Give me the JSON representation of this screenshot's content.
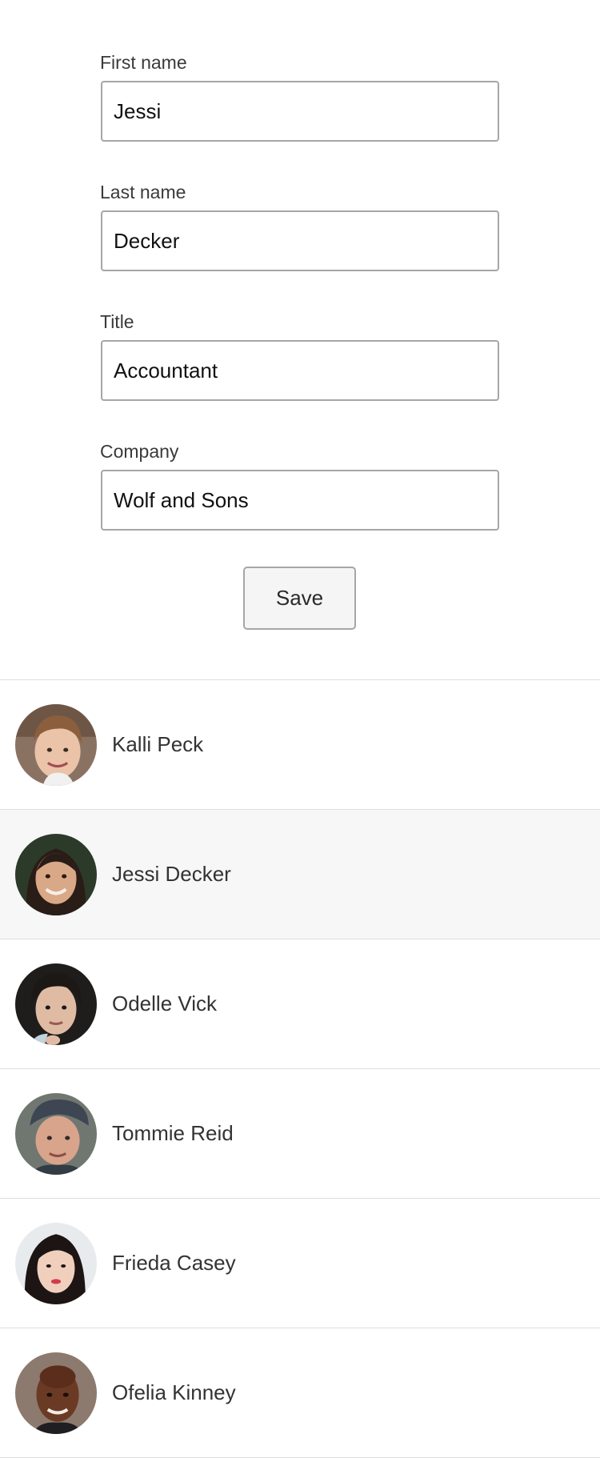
{
  "form": {
    "fields": [
      {
        "label": "First name",
        "value": "Jessi"
      },
      {
        "label": "Last name",
        "value": "Decker"
      },
      {
        "label": "Title",
        "value": "Accountant"
      },
      {
        "label": "Company",
        "value": "Wolf and Sons"
      }
    ],
    "save_label": "Save"
  },
  "people": [
    {
      "name": "Kalli Peck",
      "selected": false,
      "avatar": "avatar-photo"
    },
    {
      "name": "Jessi Decker",
      "selected": true,
      "avatar": "avatar-photo"
    },
    {
      "name": "Odelle Vick",
      "selected": false,
      "avatar": "avatar-photo"
    },
    {
      "name": "Tommie Reid",
      "selected": false,
      "avatar": "avatar-photo"
    },
    {
      "name": "Frieda Casey",
      "selected": false,
      "avatar": "avatar-photo"
    },
    {
      "name": "Ofelia Kinney",
      "selected": false,
      "avatar": "avatar-photo"
    }
  ]
}
